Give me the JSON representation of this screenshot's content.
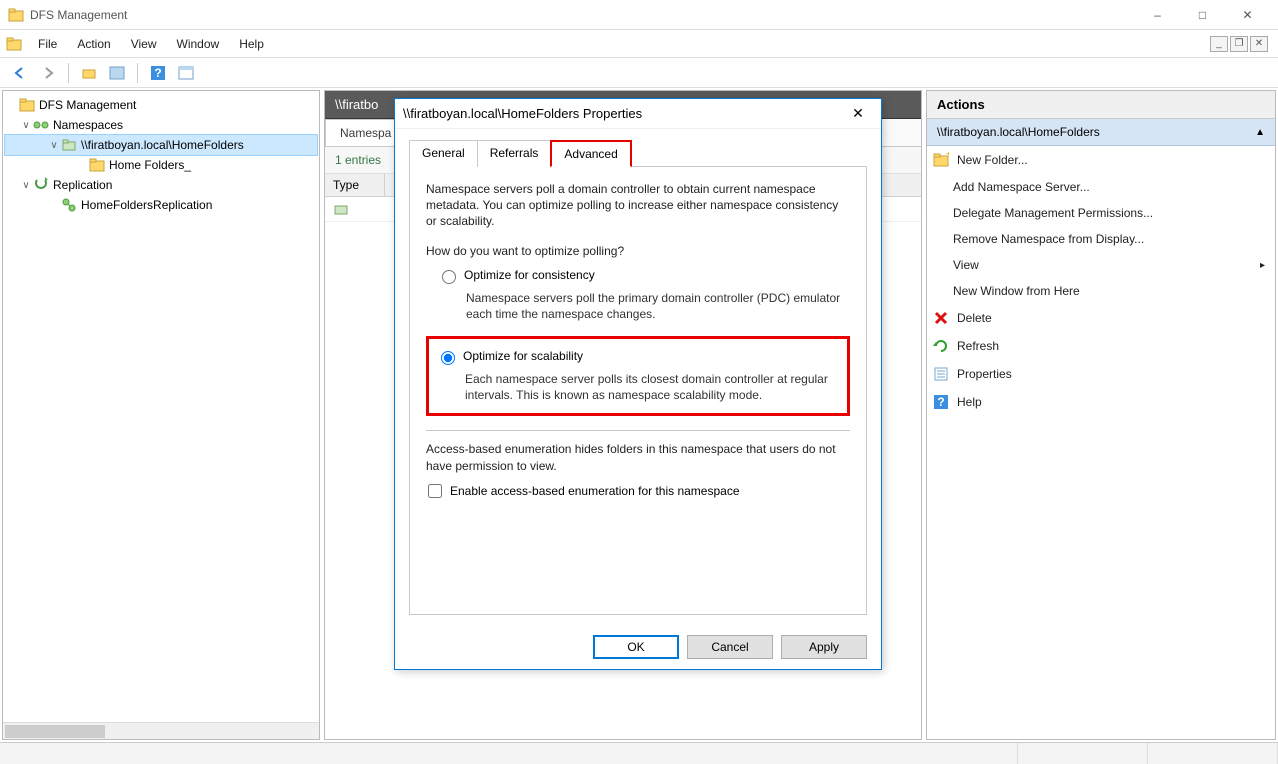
{
  "window": {
    "title": "DFS Management",
    "menus": [
      "File",
      "Action",
      "View",
      "Window",
      "Help"
    ]
  },
  "tree": {
    "root": "DFS Management",
    "namespaces": "Namespaces",
    "ns_path": "\\\\firatboyan.local\\HomeFolders",
    "home_folders": "Home Folders_",
    "replication": "Replication",
    "rep_group": "HomeFoldersReplication"
  },
  "middle": {
    "header": "\\\\firatbo",
    "tab1": "Namespa",
    "subhead": "1 entries",
    "col_type": "Type"
  },
  "actions": {
    "header": "Actions",
    "section": "\\\\firatboyan.local\\HomeFolders",
    "items": {
      "new_folder": "New Folder...",
      "add_ns_server": "Add Namespace Server...",
      "delegate": "Delegate Management Permissions...",
      "remove_display": "Remove Namespace from Display...",
      "view": "View",
      "new_window": "New Window from Here",
      "delete": "Delete",
      "refresh": "Refresh",
      "properties": "Properties",
      "help": "Help"
    }
  },
  "dialog": {
    "title": "\\\\firatboyan.local\\HomeFolders Properties",
    "tabs": {
      "general": "General",
      "referrals": "Referrals",
      "advanced": "Advanced"
    },
    "intro": "Namespace servers poll a domain controller to obtain current namespace metadata. You can optimize polling to increase either namespace consistency or scalability.",
    "question": "How do you want to optimize polling?",
    "opt_consistency": "Optimize for consistency",
    "opt_consistency_desc": "Namespace servers poll the primary domain controller (PDC) emulator each time the namespace changes.",
    "opt_scalability": "Optimize for scalability",
    "opt_scalability_desc": "Each namespace server polls its closest domain controller at regular intervals. This is known as namespace scalability mode.",
    "abe_desc": "Access-based enumeration hides folders in this namespace that users do not have permission to view.",
    "abe_check": "Enable access-based enumeration for this namespace",
    "ok": "OK",
    "cancel": "Cancel",
    "apply": "Apply"
  }
}
